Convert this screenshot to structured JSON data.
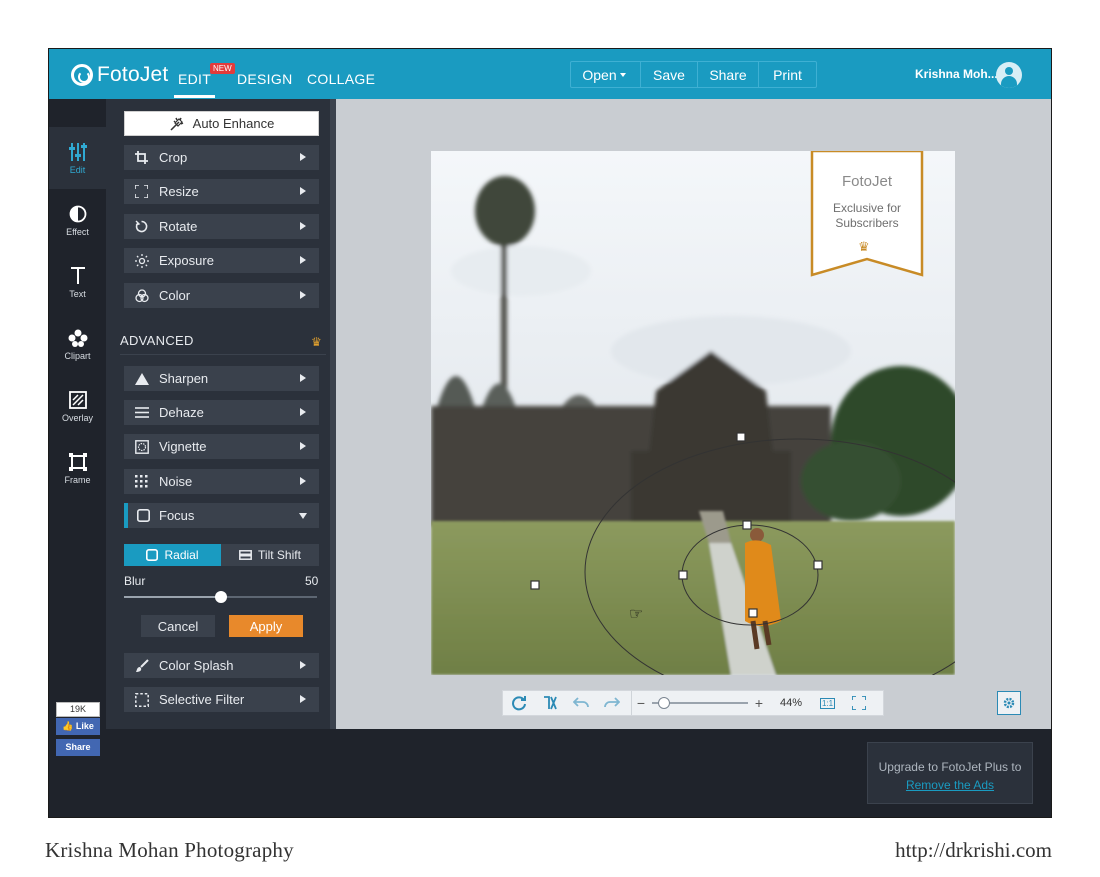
{
  "app": {
    "logo_text": "FotoJet",
    "nav_tabs": [
      {
        "label": "EDIT",
        "active": true,
        "badge": "NEW"
      },
      {
        "label": "DESIGN"
      },
      {
        "label": "COLLAGE"
      }
    ],
    "menu": {
      "open": "Open",
      "save": "Save",
      "share": "Share",
      "print": "Print"
    },
    "user_name": "Krishna Moh...",
    "brand_color": "#1a9bc1"
  },
  "rail": {
    "items": [
      {
        "label": "Edit",
        "icon": "sliders-icon",
        "active": true
      },
      {
        "label": "Effect",
        "icon": "half-circle-icon"
      },
      {
        "label": "Text",
        "icon": "text-t-icon"
      },
      {
        "label": "Clipart",
        "icon": "clover-icon"
      },
      {
        "label": "Overlay",
        "icon": "overlay-icon"
      },
      {
        "label": "Frame",
        "icon": "frame-icon"
      }
    ],
    "facebook": {
      "count": "19K",
      "like": "Like",
      "share": "Share"
    }
  },
  "panel": {
    "auto_enhance": "Auto Enhance",
    "basic_tools": [
      {
        "label": "Crop",
        "icon": "crop-icon"
      },
      {
        "label": "Resize",
        "icon": "resize-icon"
      },
      {
        "label": "Rotate",
        "icon": "rotate-icon"
      },
      {
        "label": "Exposure",
        "icon": "sun-icon"
      },
      {
        "label": "Color",
        "icon": "color-circles-icon"
      }
    ],
    "advanced_title": "ADVANCED",
    "advanced_tools": [
      {
        "label": "Sharpen",
        "icon": "triangle-icon"
      },
      {
        "label": "Dehaze",
        "icon": "lines-icon"
      },
      {
        "label": "Vignette",
        "icon": "vignette-icon"
      },
      {
        "label": "Noise",
        "icon": "dots-grid-icon"
      },
      {
        "label": "Focus",
        "icon": "focus-square-icon",
        "open": true
      }
    ],
    "focus": {
      "modes": [
        "Radial",
        "Tilt Shift"
      ],
      "selected_mode": "Radial",
      "blur_label": "Blur",
      "blur_value": "50",
      "blur_fraction": 0.5,
      "cancel": "Cancel",
      "apply": "Apply",
      "apply_color": "#e8892b"
    },
    "more_tools": [
      {
        "label": "Color Splash",
        "icon": "brush-icon"
      },
      {
        "label": "Selective Filter",
        "icon": "dashed-square-icon"
      }
    ]
  },
  "canvas": {
    "watermark_brand": "FotoJet",
    "watermark_line1": "Exclusive for",
    "watermark_line2": "Subscribers",
    "zoom_level": "44%",
    "zoom_fraction": 0.13,
    "fit_label": "1:1"
  },
  "ads": {
    "text": "Upgrade to FotoJet Plus to",
    "link": "Remove the Ads"
  },
  "captions": {
    "left": "Krishna Mohan Photography",
    "right": "http://drkrishi.com"
  }
}
